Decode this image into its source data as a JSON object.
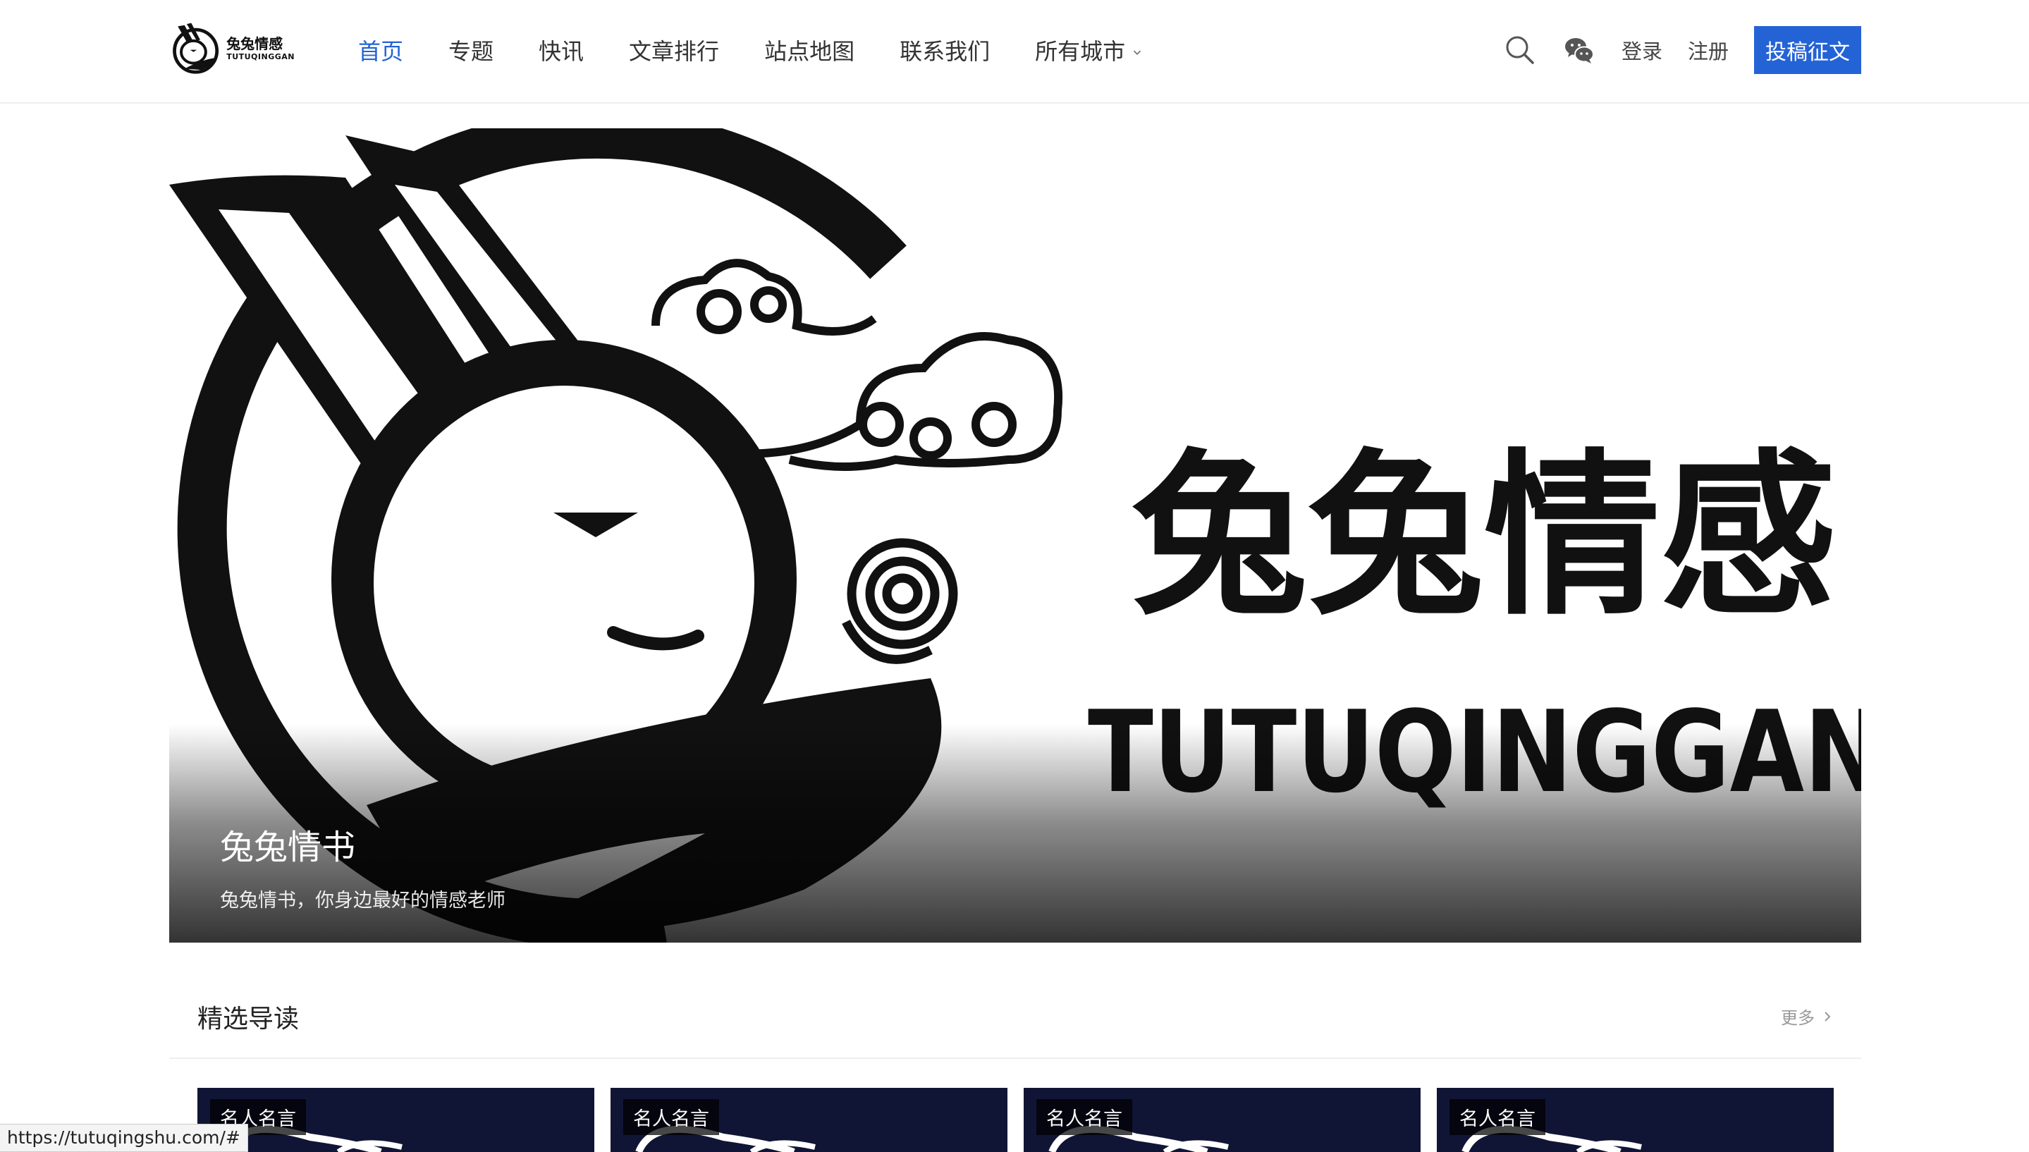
{
  "site": {
    "logo_cn": "兔兔情感",
    "logo_en": "TUTUQINGGAN"
  },
  "nav": {
    "items": [
      {
        "label": "首页",
        "active": true
      },
      {
        "label": "专题",
        "active": false
      },
      {
        "label": "快讯",
        "active": false
      },
      {
        "label": "文章排行",
        "active": false
      },
      {
        "label": "站点地图",
        "active": false
      },
      {
        "label": "联系我们",
        "active": false
      },
      {
        "label": "所有城市",
        "active": false,
        "has_dropdown": true
      }
    ]
  },
  "header_actions": {
    "search_icon": "search-icon",
    "wechat_icon": "wechat-icon",
    "login_label": "登录",
    "register_label": "注册",
    "submit_label": "投稿征文"
  },
  "hero": {
    "art_title_cn": "兔兔情感",
    "art_title_en": "TUTUQINGGAN",
    "title": "兔兔情书",
    "subtitle": "兔兔情书，你身边最好的情感老师"
  },
  "featured": {
    "title": "精选导读",
    "more_label": "更多",
    "cards": [
      {
        "tag": "名人名言"
      },
      {
        "tag": "名人名言"
      },
      {
        "tag": "名人名言"
      },
      {
        "tag": "名人名言"
      }
    ]
  },
  "status_bar": {
    "url": "https://tutuqingshu.com/#"
  },
  "colors": {
    "accent": "#2463d6",
    "card_bg": "#111535"
  }
}
